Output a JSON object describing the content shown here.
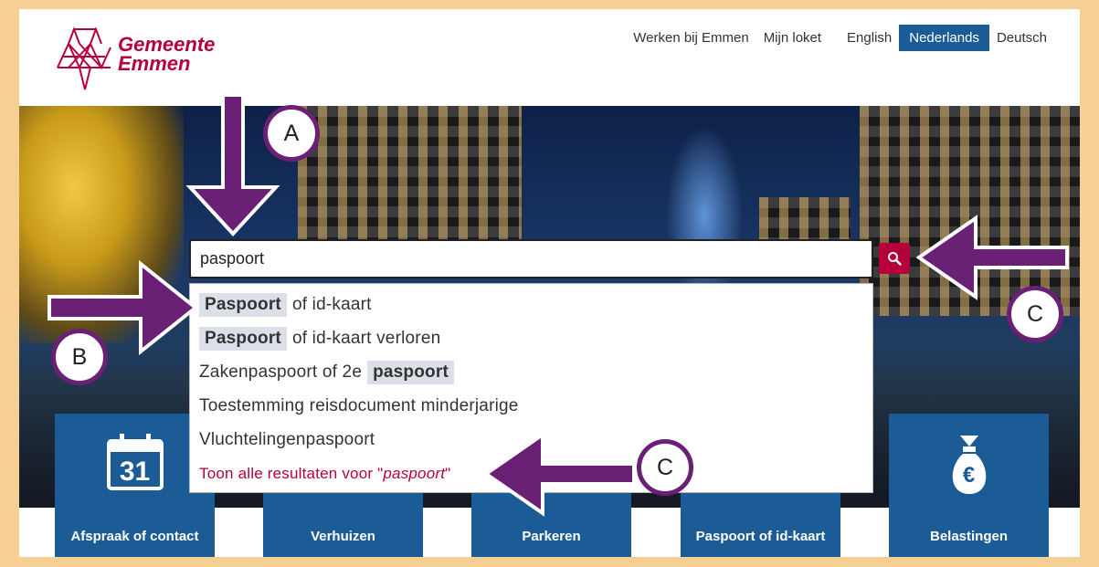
{
  "logo": {
    "line1": "Gemeente",
    "line2": "Emmen"
  },
  "topnav": {
    "werken": "Werken bij Emmen",
    "loket": "Mijn loket",
    "english": "English",
    "nederlands": "Nederlands",
    "deutsch": "Deutsch"
  },
  "search": {
    "value": "paspoort",
    "button_icon": "search-icon"
  },
  "suggestions": [
    {
      "bold": "Paspoort",
      "rest": "of id-kaart"
    },
    {
      "bold": "Paspoort",
      "rest": "of id-kaart verloren"
    },
    {
      "prefix": "Zakenpaspoort of 2e",
      "bold": "paspoort"
    },
    {
      "text": "Toestemming reisdocument minderjarige"
    },
    {
      "text": "Vluchtelingenpaspoort"
    }
  ],
  "show_all": {
    "before": "Toon alle resultaten voor \"",
    "term": "paspoort",
    "after": "\""
  },
  "tiles": {
    "afspraak": {
      "label": "Afspraak of contact",
      "day": "31",
      "icon": "calendar-icon"
    },
    "verhuizen": {
      "label": "Verhuizen"
    },
    "parkeren": {
      "label": "Parkeren"
    },
    "paspoort": {
      "label": "Paspoort of id-kaart"
    },
    "belastingen": {
      "label": "Belastingen",
      "symbol": "€",
      "icon": "money-bag-icon"
    }
  },
  "annotations": {
    "a": "A",
    "b": "B",
    "c1": "C",
    "c2": "C"
  },
  "colors": {
    "brand": "#b5003c",
    "blue": "#1b5c97",
    "annotation": "#6a2075",
    "frame": "#f6cf95"
  }
}
